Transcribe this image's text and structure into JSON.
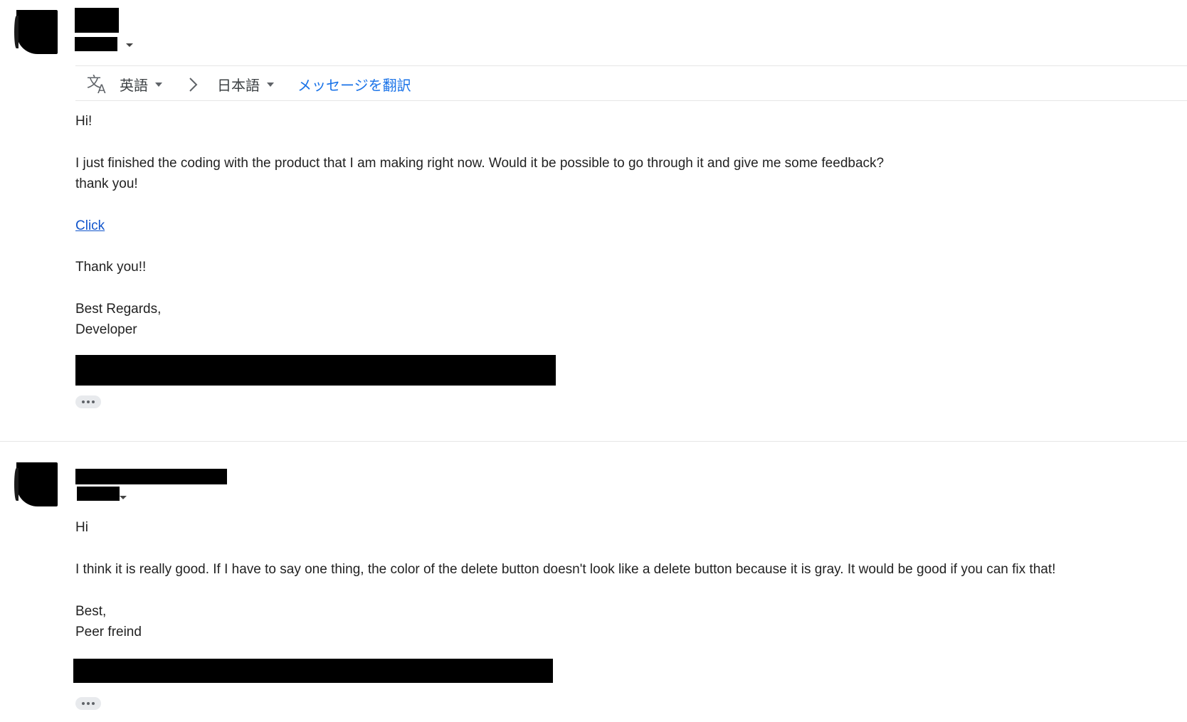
{
  "translation_bar": {
    "source_language": "英語",
    "target_language": "日本語",
    "translate_link": "メッセージを翻訳"
  },
  "message1": {
    "body": [
      "Hi!",
      "I just finished the coding with the product that I am making right now. Would it be possible to go through it and give me some feedback?",
      "thank you!"
    ],
    "link_text": "Click",
    "closing": [
      "Thank you!!",
      "Best Regards,",
      "Developer"
    ]
  },
  "message2": {
    "body": [
      "Hi",
      "I think it is really good. If I have to say one thing, the color of the delete button doesn't look like a delete button because it is gray. It would be good if you can fix that!"
    ],
    "closing": [
      "Best,",
      "Peer freind"
    ]
  },
  "icons": {
    "translate": "translate-icon",
    "chevron": "chevron-right-icon",
    "dropdown": "caret-down-icon",
    "more": "ellipsis-icon"
  },
  "colors": {
    "link": "#1155cc",
    "translate_link": "#1a73e8",
    "redaction": "#000000"
  }
}
